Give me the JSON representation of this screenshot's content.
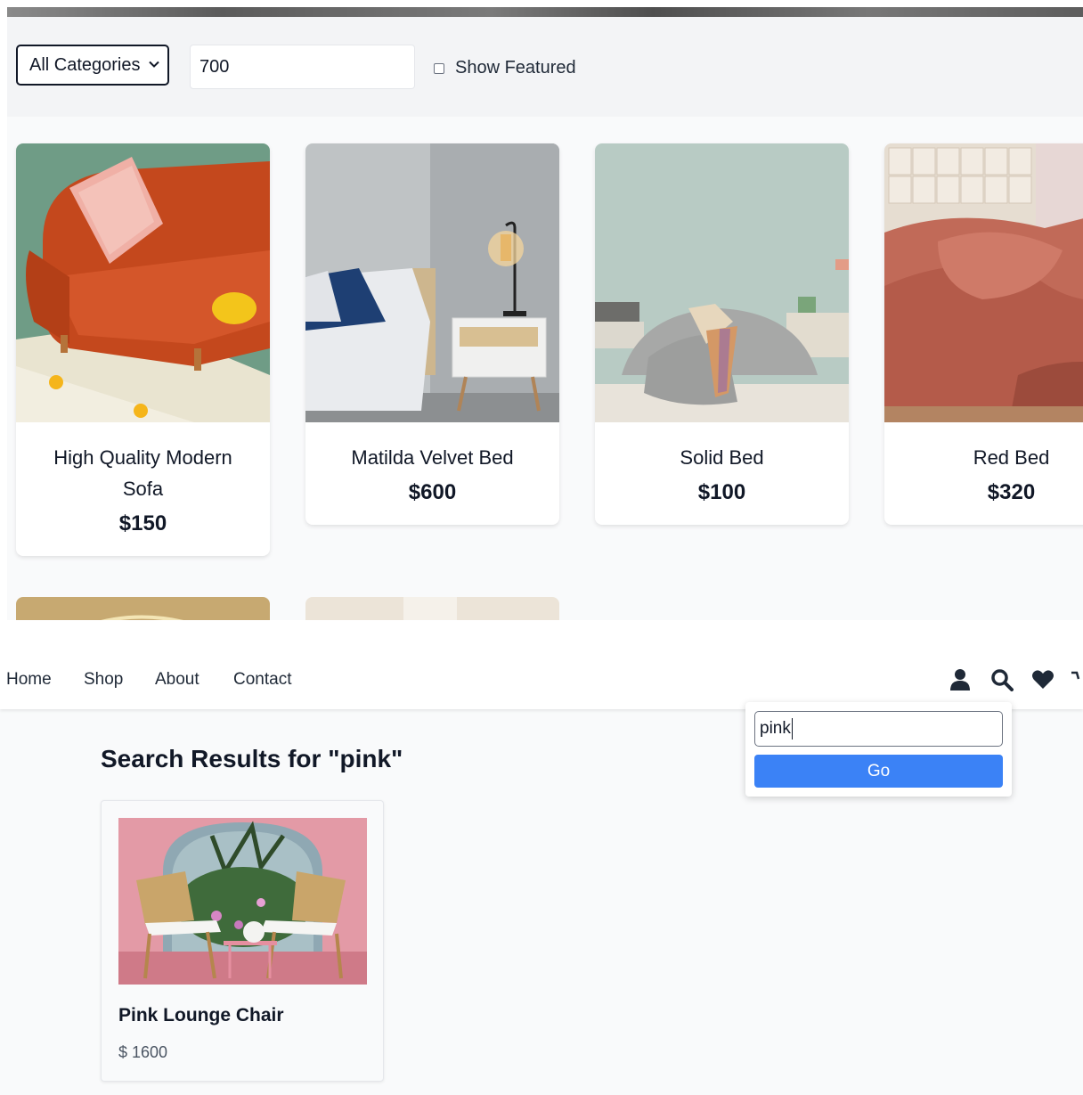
{
  "filters": {
    "category_selected": "All Categories",
    "price_value": "700",
    "featured_label": "Show Featured",
    "featured_checked": false
  },
  "products": [
    {
      "title": "High Quality Modern Sofa",
      "price": "$150"
    },
    {
      "title": "Matilda Velvet Bed",
      "price": "$600"
    },
    {
      "title": "Solid Bed",
      "price": "$100"
    },
    {
      "title": "Red Bed",
      "price": "$320"
    }
  ],
  "nav": {
    "links": [
      "Home",
      "Shop",
      "About",
      "Contact"
    ],
    "icons": [
      "user-icon",
      "search-icon",
      "heart-icon",
      "cart-icon"
    ]
  },
  "search": {
    "query": "pink",
    "go_label": "Go",
    "results_title": "Search Results for \"pink\"",
    "results": [
      {
        "title": "Pink Lounge Chair",
        "price": "$ 1600"
      }
    ]
  },
  "colors": {
    "accent": "#3b82f6",
    "text": "#111827",
    "page_bg": "#f9fafb"
  }
}
